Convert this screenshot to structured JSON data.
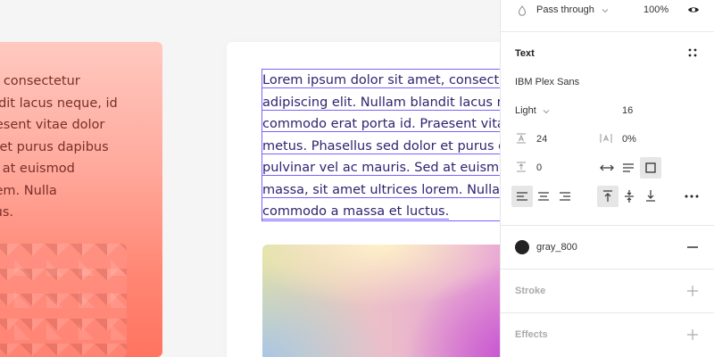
{
  "canvas": {
    "left_card_text": "et, consectetur\nandit lacus neque, id\nraesent vitae dolor\nor et purus dapibus\ned at euismod\norem. Nulla\nctus.",
    "selected_text_lines": [
      "Lorem ipsum dolor sit amet, consecte",
      "adipiscing elit. Nullam blandit lacus ne",
      "commodo erat porta id. Praesent vitae",
      "metus. Phasellus sed dolor et purus d",
      "pulvinar vel ac mauris. Sed at euismod",
      "massa, sit amet ultrices lorem. Nulla",
      "commodo a massa et luctus."
    ]
  },
  "panel": {
    "layer": {
      "blend_mode": "Pass through",
      "opacity": "100%"
    },
    "text": {
      "section_title": "Text",
      "font_family": "IBM Plex Sans",
      "font_weight": "Light",
      "font_size": "16",
      "line_height": "24",
      "letter_spacing": "0%",
      "paragraph_spacing": "0"
    },
    "fill": {
      "style_name": "gray_800",
      "swatch_color": "#222222"
    },
    "stroke": {
      "title": "Stroke"
    },
    "effects": {
      "title": "Effects"
    }
  },
  "colors": {
    "selection": "#7b61ff",
    "active_button_bg": "#e6e6e6"
  }
}
